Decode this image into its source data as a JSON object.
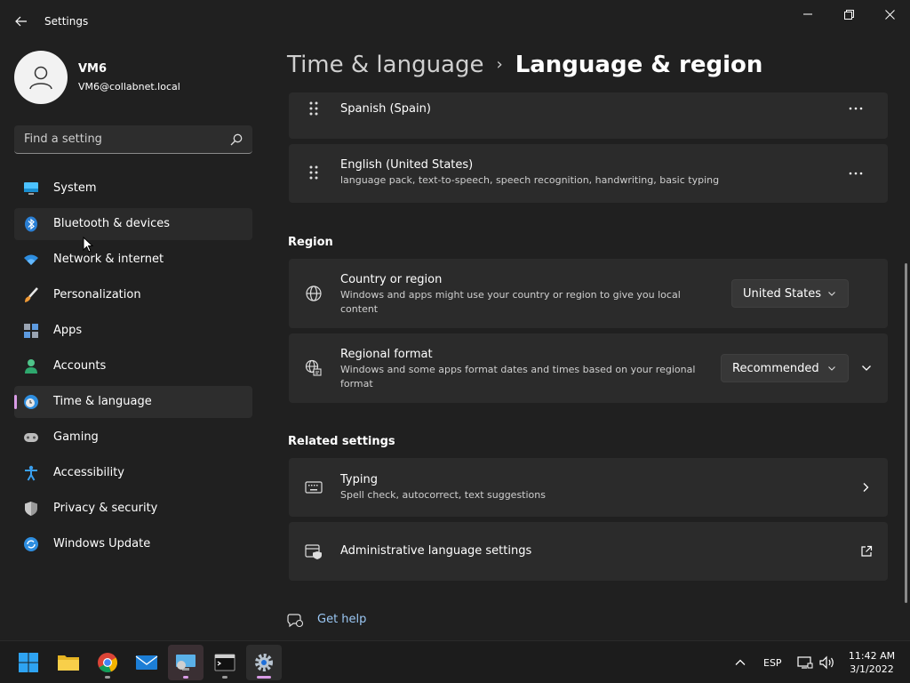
{
  "window": {
    "title": "Settings"
  },
  "user": {
    "name": "VM6",
    "email": "VM6@collabnet.local"
  },
  "search": {
    "placeholder": "Find a setting"
  },
  "sidebar": {
    "items": [
      {
        "label": "System",
        "icon": "monitor-icon"
      },
      {
        "label": "Bluetooth & devices",
        "icon": "bluetooth-icon"
      },
      {
        "label": "Network & internet",
        "icon": "wifi-icon"
      },
      {
        "label": "Personalization",
        "icon": "brush-icon"
      },
      {
        "label": "Apps",
        "icon": "apps-icon"
      },
      {
        "label": "Accounts",
        "icon": "person-icon"
      },
      {
        "label": "Time & language",
        "icon": "clock-globe-icon"
      },
      {
        "label": "Gaming",
        "icon": "gamepad-icon"
      },
      {
        "label": "Accessibility",
        "icon": "accessibility-icon"
      },
      {
        "label": "Privacy & security",
        "icon": "shield-icon"
      },
      {
        "label": "Windows Update",
        "icon": "update-icon"
      }
    ],
    "selected": "Time & language",
    "hovered": "Bluetooth & devices"
  },
  "breadcrumb": {
    "parent": "Time & language",
    "separator": "›",
    "current": "Language & region"
  },
  "languages": [
    {
      "name": "Spanish (Spain)",
      "features": ""
    },
    {
      "name": "English (United States)",
      "features": "language pack, text-to-speech, speech recognition, handwriting, basic typing"
    }
  ],
  "region": {
    "heading": "Region",
    "country": {
      "title": "Country or region",
      "description": "Windows and apps might use your country or region to give you local content",
      "value": "United States"
    },
    "format": {
      "title": "Regional format",
      "description": "Windows and some apps format dates and times based on your regional format",
      "value": "Recommended"
    }
  },
  "related": {
    "heading": "Related settings",
    "typing": {
      "title": "Typing",
      "description": "Spell check, autocorrect, text suggestions"
    },
    "admin": {
      "title": "Administrative language settings"
    }
  },
  "help": {
    "label": "Get help"
  },
  "taskbar": {
    "apps": [
      "start-icon",
      "file-explorer-icon",
      "chrome-icon",
      "mail-icon",
      "remote-desktop-icon",
      "terminal-icon",
      "settings-icon"
    ],
    "language": "ESP",
    "time": "11:42 AM",
    "date": "3/1/2022"
  },
  "colors": {
    "accent": "#d99ce6",
    "link": "#9bc8f5",
    "background": "#202020",
    "card": "#2b2b2b"
  }
}
